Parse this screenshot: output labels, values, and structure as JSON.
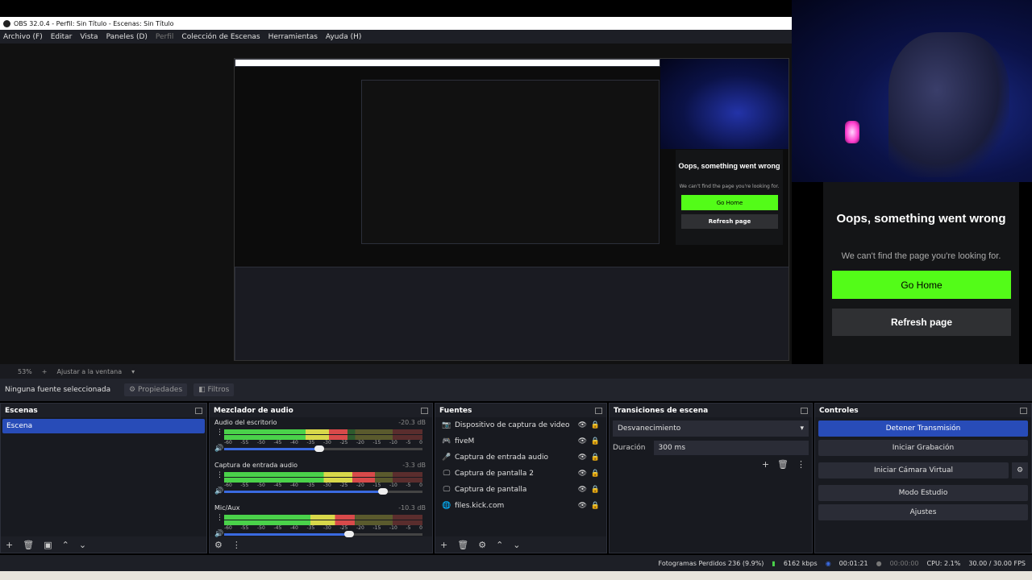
{
  "window": {
    "title": "OBS 32.0.4 - Perfil: Sin Título - Escenas: Sin Título"
  },
  "menu": [
    "Archivo (F)",
    "Editar",
    "Vista",
    "Paneles (D)",
    "Perfil",
    "Colección de Escenas",
    "Herramientas",
    "Ayuda (H)"
  ],
  "web_error": {
    "heading": "Oops, something went wrong",
    "message": "We can't find the page you're looking for.",
    "go_home": "Go Home",
    "refresh": "Refresh page"
  },
  "zoombar": {
    "zoom": "53%",
    "fit": "Ajustar a la ventana"
  },
  "propbar": {
    "no_source": "Ninguna fuente seleccionada",
    "properties": "Propiedades",
    "filters": "Filtros"
  },
  "scenes": {
    "title": "Escenas",
    "items": [
      "Escena"
    ]
  },
  "mixer": {
    "title": "Mezclador de audio",
    "ticks": [
      "-60",
      "-55",
      "-50",
      "-45",
      "-40",
      "-35",
      "-30",
      "-25",
      "-20",
      "-15",
      "-10",
      "-5",
      "0"
    ],
    "channels": [
      {
        "name": "Audio del escritorio",
        "db": "-20.3 dB",
        "level": 0.62,
        "volume": 0.48
      },
      {
        "name": "Captura de entrada audio",
        "db": "-3.3 dB",
        "level": 0.76,
        "volume": 0.8
      },
      {
        "name": "Mic/Aux",
        "db": "-10.3 dB",
        "level": 0.66,
        "volume": 0.63
      }
    ]
  },
  "sources": {
    "title": "Fuentes",
    "items": [
      {
        "name": "Dispositivo de captura de video",
        "icon": "camera-icon"
      },
      {
        "name": "fiveM",
        "icon": "gamepad-icon"
      },
      {
        "name": "Captura de entrada audio",
        "icon": "mic-icon"
      },
      {
        "name": "Captura de pantalla 2",
        "icon": "monitor-icon"
      },
      {
        "name": "Captura de pantalla",
        "icon": "monitor-icon"
      },
      {
        "name": "files.kick.com",
        "icon": "globe-icon"
      }
    ]
  },
  "transitions": {
    "title": "Transiciones de escena",
    "selected": "Desvanecimiento",
    "duration_label": "Duración",
    "duration_value": "300 ms"
  },
  "controls": {
    "title": "Controles",
    "buttons": [
      "Detener Transmisión",
      "Iniciar Grabación",
      "Iniciar Cámara Virtual",
      "Modo Estudio",
      "Ajustes"
    ]
  },
  "status": {
    "dropped": "Fotogramas Perdidos 236 (9.9%)",
    "bitrate": "6162 kbps",
    "stream_time": "00:01:21",
    "rec_time": "00:00:00",
    "cpu": "CPU: 2.1%",
    "fps": "30.00 / 30.00 FPS"
  }
}
